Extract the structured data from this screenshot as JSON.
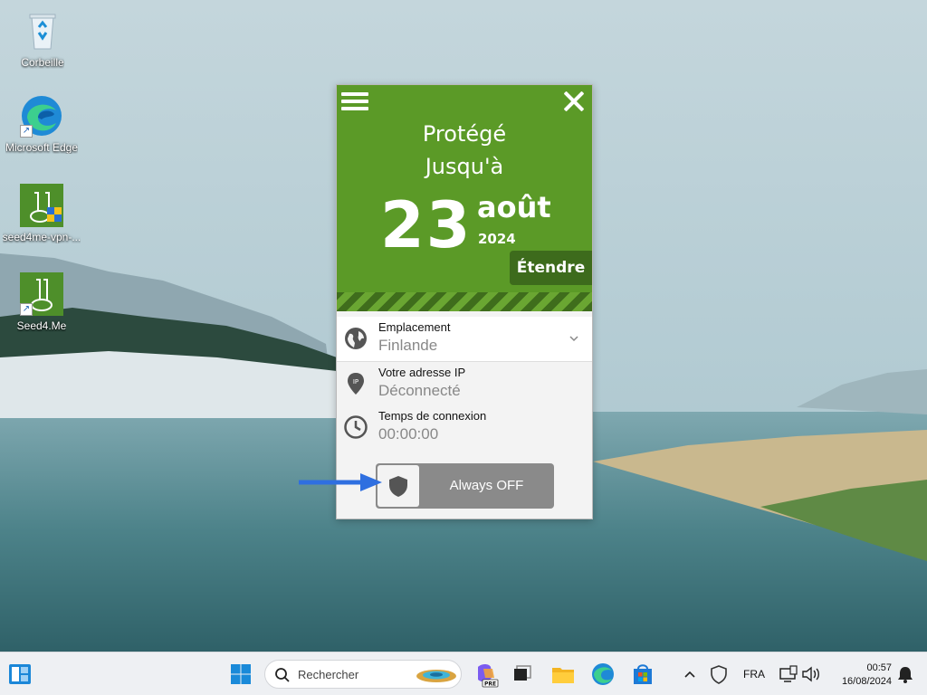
{
  "desktop": {
    "icons": [
      {
        "label": "Corbeille",
        "icon": "recycle-bin-icon"
      },
      {
        "label": "Microsoft Edge",
        "icon": "edge-icon"
      },
      {
        "label": "seed4me-vpn-...",
        "icon": "seed4me-installer-icon"
      },
      {
        "label": "Seed4.Me",
        "icon": "seed4me-icon"
      }
    ]
  },
  "vpn": {
    "status_line1": "Protégé",
    "status_line2": "Jusqu'à",
    "expiry_day": "23",
    "expiry_month": "août",
    "expiry_year": "2024",
    "extend_label": "Étendre",
    "location": {
      "label": "Emplacement",
      "value": "Finlande"
    },
    "ip": {
      "label": "Votre adresse IP",
      "value": "Déconnecté",
      "icon_text": "IP"
    },
    "connection_time": {
      "label": "Temps de connexion",
      "value": "00:00:00"
    },
    "toggle_label": "Always OFF",
    "colors": {
      "header": "#5b9a27",
      "extend": "#3d6b1c",
      "toggle": "#8a8a8a",
      "arrow": "#2f6fe0"
    }
  },
  "taskbar": {
    "search_placeholder": "Rechercher",
    "language": "FRA",
    "time": "00:57",
    "date": "16/08/2024",
    "copilot_badge": "PRE"
  }
}
